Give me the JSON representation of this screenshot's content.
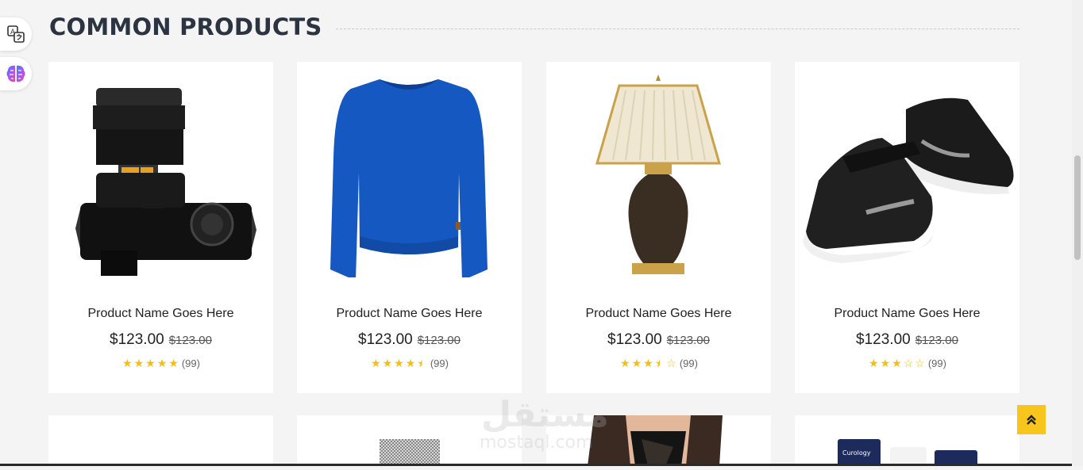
{
  "section": {
    "title": "COMMON PRODUCTS"
  },
  "products": [
    {
      "name": "Product Name Goes Here",
      "price": "$123.00",
      "old_price": "$123.00",
      "rating": 5,
      "reviews": "(99)",
      "image": "camera"
    },
    {
      "name": "Product Name Goes Here",
      "price": "$123.00",
      "old_price": "$123.00",
      "rating": 4.5,
      "reviews": "(99)",
      "image": "sweater"
    },
    {
      "name": "Product Name Goes Here",
      "price": "$123.00",
      "old_price": "$123.00",
      "rating": 3.5,
      "reviews": "(99)",
      "image": "lamp"
    },
    {
      "name": "Product Name Goes Here",
      "price": "$123.00",
      "old_price": "$123.00",
      "rating": 3,
      "reviews": "(99)",
      "image": "sneakers"
    }
  ],
  "second_row_images": [
    "blank",
    "scarf",
    "woman",
    "skincare"
  ],
  "watermark": {
    "arabic": "مستقل",
    "latin": "mostaql.com"
  },
  "colors": {
    "accent": "#f8c51c",
    "star": "#f6bd16",
    "background": "#f4f4f4"
  },
  "icons": [
    "translate-icon",
    "brain-icon",
    "double-chevron-up-icon"
  ]
}
